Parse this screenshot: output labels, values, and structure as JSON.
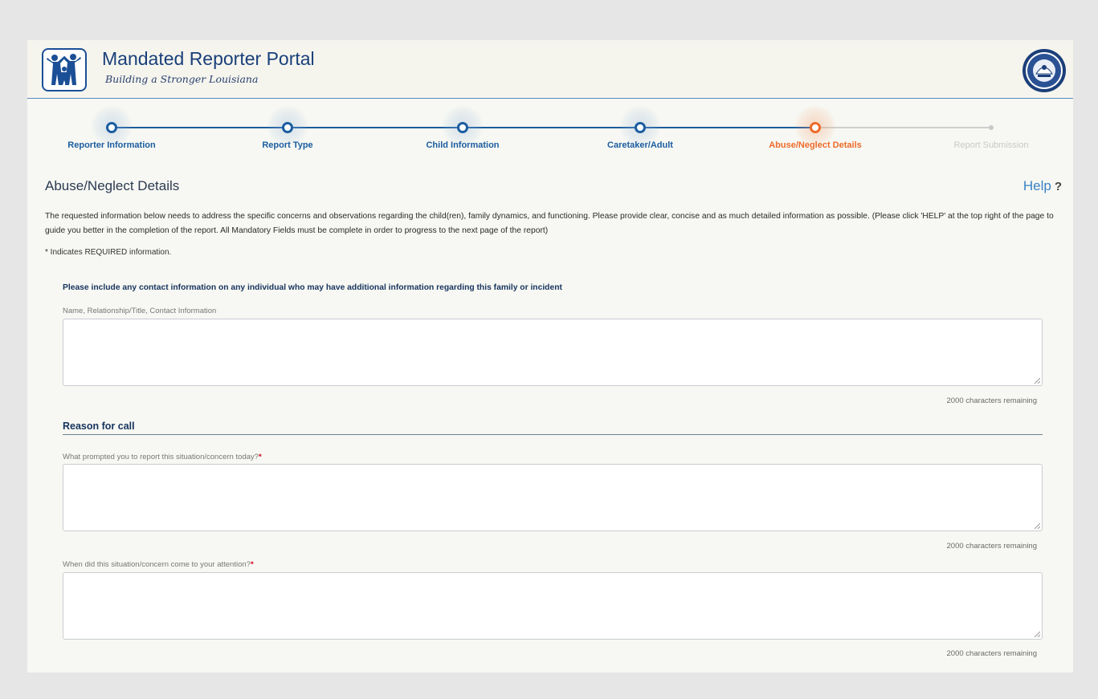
{
  "header": {
    "title": "Mandated Reporter Portal",
    "tagline": "Building a Stronger Louisiana"
  },
  "stepper": {
    "steps": [
      {
        "label": "Reporter Information",
        "state": "done"
      },
      {
        "label": "Report Type",
        "state": "done"
      },
      {
        "label": "Child Information",
        "state": "done"
      },
      {
        "label": "Caretaker/Adult",
        "state": "done"
      },
      {
        "label": "Abuse/Neglect Details",
        "state": "active"
      },
      {
        "label": "Report Submission",
        "state": "pending"
      }
    ],
    "colors": {
      "done": "#1b5da0",
      "active": "#ee6a2a",
      "pending": "#c9c9c9"
    }
  },
  "page": {
    "heading": "Abuse/Neglect Details",
    "help_label": "Help",
    "help_icon": "?",
    "intro": "The requested information below needs to address the specific concerns and observations regarding the child(ren), family dynamics, and functioning. Please provide clear, concise and as much detailed information as possible. (Please click 'HELP' at the top right of the page to guide you better in the completion of the report. All Mandatory Fields must be complete in order to progress to the next page of the report)",
    "required_note": "* Indicates REQUIRED information."
  },
  "contact": {
    "heading": "Please include any contact information on any individual who may have additional information regarding this family or incident",
    "label": "Name, Relationship/Title, Contact Information",
    "value": "",
    "remaining": "2000 characters remaining"
  },
  "reason": {
    "title": "Reason for call",
    "q1": {
      "label": "What prompted you to report this situation/concern today?",
      "required_mark": "*",
      "value": "",
      "remaining": "2000 characters remaining"
    },
    "q2": {
      "label": "When did this situation/concern come to your attention?",
      "required_mark": "*",
      "value": "",
      "remaining": "2000 characters remaining"
    }
  }
}
